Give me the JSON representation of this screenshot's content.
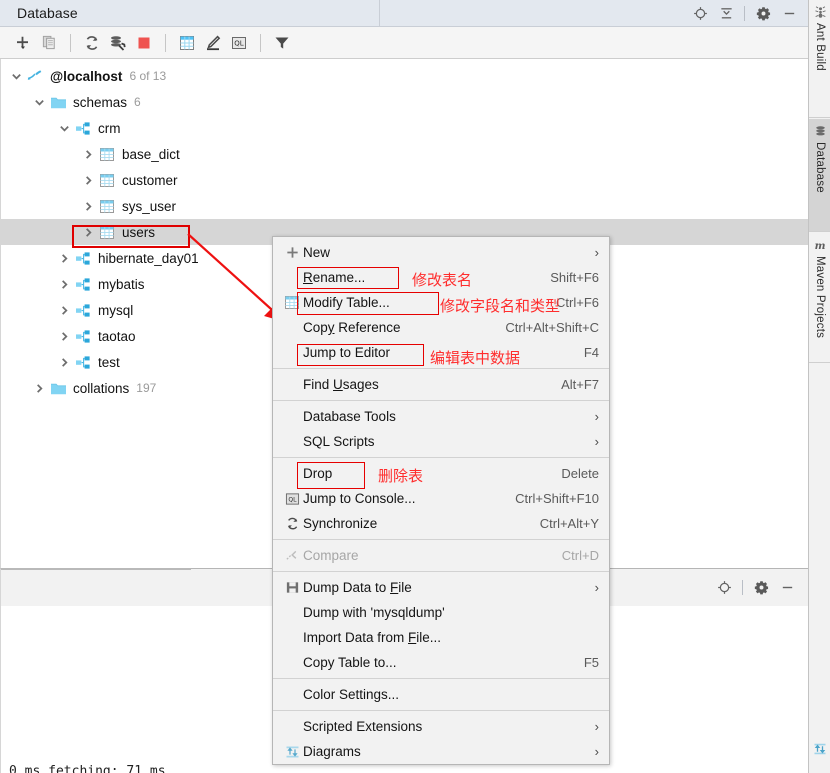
{
  "window": {
    "tab_title": "Database",
    "titlebar_icons": [
      "locate-icon",
      "collapse-all-icon",
      "gear-icon",
      "minimize-icon"
    ]
  },
  "toolbar": {
    "items": [
      {
        "name": "add-icon",
        "tooltip": "New"
      },
      {
        "name": "copy-icon",
        "tooltip": "Duplicate"
      },
      {
        "name": "refresh-icon",
        "tooltip": "Synchronize"
      },
      {
        "name": "data-source-properties-icon",
        "tooltip": "Data Source Properties"
      },
      {
        "name": "stop-icon",
        "tooltip": "Stop"
      },
      {
        "name": "table-icon",
        "tooltip": "Jump to Data"
      },
      {
        "name": "edit-icon",
        "tooltip": "Modify"
      },
      {
        "name": "sql-console-icon",
        "tooltip": "Jump to Console"
      },
      {
        "name": "filter-icon",
        "tooltip": "Filter"
      }
    ]
  },
  "tree": {
    "nodes": [
      {
        "indent": 0,
        "twist": "expanded",
        "icon": "mysql-datasource-icon",
        "label": "@localhost",
        "bold": true,
        "count": "6 of 13",
        "selected": false
      },
      {
        "indent": 1,
        "twist": "expanded",
        "icon": "folder-icon",
        "label": "schemas",
        "bold": false,
        "count": "6",
        "selected": false
      },
      {
        "indent": 2,
        "twist": "expanded",
        "icon": "schema-icon",
        "label": "crm",
        "bold": false,
        "count": "",
        "selected": false
      },
      {
        "indent": 3,
        "twist": "collapsed",
        "icon": "table-icon",
        "label": "base_dict",
        "bold": false,
        "count": "",
        "selected": false
      },
      {
        "indent": 3,
        "twist": "collapsed",
        "icon": "table-icon",
        "label": "customer",
        "bold": false,
        "count": "",
        "selected": false
      },
      {
        "indent": 3,
        "twist": "collapsed",
        "icon": "table-icon",
        "label": "sys_user",
        "bold": false,
        "count": "",
        "selected": false
      },
      {
        "indent": 3,
        "twist": "collapsed",
        "icon": "table-icon",
        "label": "users",
        "bold": false,
        "count": "",
        "selected": true
      },
      {
        "indent": 2,
        "twist": "collapsed",
        "icon": "schema-icon",
        "label": "hibernate_day01",
        "bold": false,
        "count": "",
        "selected": false
      },
      {
        "indent": 2,
        "twist": "collapsed",
        "icon": "schema-icon",
        "label": "mybatis",
        "bold": false,
        "count": "",
        "selected": false
      },
      {
        "indent": 2,
        "twist": "collapsed",
        "icon": "schema-icon",
        "label": "mysql",
        "bold": false,
        "count": "",
        "selected": false
      },
      {
        "indent": 2,
        "twist": "collapsed",
        "icon": "schema-icon",
        "label": "taotao",
        "bold": false,
        "count": "",
        "selected": false
      },
      {
        "indent": 2,
        "twist": "collapsed",
        "icon": "schema-icon",
        "label": "test",
        "bold": false,
        "count": "",
        "selected": false
      },
      {
        "indent": 1,
        "twist": "collapsed",
        "icon": "folder-icon",
        "label": "collations",
        "bold": false,
        "count": "197",
        "selected": false
      }
    ]
  },
  "context_menu": {
    "items": [
      {
        "icon": "plus-icon",
        "label": "New",
        "label_u": "",
        "shortcut": "",
        "submenu": true,
        "disabled": false
      },
      {
        "icon": "",
        "label": "Rename...",
        "label_u": "R",
        "shortcut": "Shift+F6",
        "submenu": false,
        "disabled": false
      },
      {
        "icon": "table-icon",
        "label": "Modify Table...",
        "label_u": "",
        "shortcut": "Ctrl+F6",
        "submenu": false,
        "disabled": false
      },
      {
        "icon": "",
        "label": "Copy Reference",
        "label_u": "y",
        "shortcut": "Ctrl+Alt+Shift+C",
        "submenu": false,
        "disabled": false
      },
      {
        "icon": "",
        "label": "Jump to Editor",
        "label_u": "",
        "shortcut": "F4",
        "submenu": false,
        "disabled": false
      },
      {
        "separator": true
      },
      {
        "icon": "",
        "label": "Find Usages",
        "label_u": "U",
        "shortcut": "Alt+F7",
        "submenu": false,
        "disabled": false
      },
      {
        "separator": true
      },
      {
        "icon": "",
        "label": "Database Tools",
        "label_u": "",
        "shortcut": "",
        "submenu": true,
        "disabled": false
      },
      {
        "icon": "",
        "label": "SQL Scripts",
        "label_u": "",
        "shortcut": "",
        "submenu": true,
        "disabled": false
      },
      {
        "separator": true
      },
      {
        "icon": "",
        "label": "Drop",
        "label_u": "",
        "shortcut": "Delete",
        "submenu": false,
        "disabled": false
      },
      {
        "icon": "sql-console-icon",
        "label": "Jump to Console...",
        "label_u": "",
        "shortcut": "Ctrl+Shift+F10",
        "submenu": false,
        "disabled": false
      },
      {
        "icon": "refresh-icon",
        "label": "Synchronize",
        "label_u": "",
        "shortcut": "Ctrl+Alt+Y",
        "submenu": false,
        "disabled": false
      },
      {
        "separator": true
      },
      {
        "icon": "compare-icon",
        "label": "Compare",
        "label_u": "",
        "shortcut": "Ctrl+D",
        "submenu": false,
        "disabled": true
      },
      {
        "separator": true
      },
      {
        "icon": "save-icon",
        "label": "Dump Data to File",
        "label_u": "F",
        "shortcut": "",
        "submenu": true,
        "disabled": false
      },
      {
        "icon": "",
        "label": "Dump with 'mysqldump'",
        "label_u": "",
        "shortcut": "",
        "submenu": false,
        "disabled": false
      },
      {
        "icon": "",
        "label": "Import Data from File...",
        "label_u": "F",
        "shortcut": "",
        "submenu": false,
        "disabled": false
      },
      {
        "icon": "",
        "label": "Copy Table to...",
        "label_u": "",
        "shortcut": "F5",
        "submenu": false,
        "disabled": false
      },
      {
        "separator": true
      },
      {
        "icon": "",
        "label": "Color Settings...",
        "label_u": "",
        "shortcut": "",
        "submenu": false,
        "disabled": false
      },
      {
        "separator": true
      },
      {
        "icon": "",
        "label": "Scripted Extensions",
        "label_u": "",
        "shortcut": "",
        "submenu": true,
        "disabled": false
      },
      {
        "icon": "diagrams-icon",
        "label": "Diagrams",
        "label_u": "",
        "shortcut": "",
        "submenu": true,
        "disabled": false
      }
    ]
  },
  "annotations": {
    "color": "#ff2d2d",
    "notes": [
      {
        "text": "修改表名",
        "meaning_for": "Rename..."
      },
      {
        "text": "修改字段名和类型",
        "meaning_for": "Modify Table..."
      },
      {
        "text": "编辑表中数据",
        "meaning_for": "Jump to Editor"
      },
      {
        "text": "删除表",
        "meaning_for": "Drop"
      }
    ],
    "highlighted_tree_node": "users",
    "highlighted_menu_items": [
      "Rename...",
      "Modify Table...",
      "Jump to Editor",
      "Drop"
    ]
  },
  "bottom_panel": {
    "icons": [
      "locate-icon",
      "gear-icon",
      "minimize-icon"
    ]
  },
  "console": {
    "text": "0 ms  fetching: 71 ms"
  },
  "right_tool_tabs": [
    {
      "label": "Ant Build",
      "icon": "ant-icon",
      "active": false
    },
    {
      "label": "Database",
      "icon": "database-icon",
      "active": true
    },
    {
      "label": "Maven Projects",
      "icon": "maven-icon",
      "active": false
    }
  ]
}
